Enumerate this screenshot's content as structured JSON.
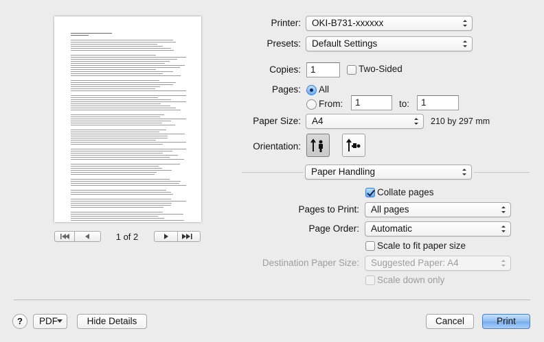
{
  "preview": {
    "page_indicator": "1 of 2"
  },
  "printer": {
    "label": "Printer:",
    "value": "OKI-B731-xxxxxx"
  },
  "presets": {
    "label": "Presets:",
    "value": "Default Settings"
  },
  "copies": {
    "label": "Copies:",
    "value": "1",
    "two_sided_label": "Two-Sided",
    "two_sided_checked": false
  },
  "pages": {
    "label": "Pages:",
    "all_label": "All",
    "from_label": "From:",
    "from_value": "1",
    "to_label": "to:",
    "to_value": "1",
    "selected": "All"
  },
  "paper_size": {
    "label": "Paper Size:",
    "value": "A4",
    "dimensions": "210 by 297 mm"
  },
  "orientation": {
    "label": "Orientation:",
    "selected": "portrait"
  },
  "section": {
    "value": "Paper Handling"
  },
  "collate": {
    "label": "Collate pages",
    "checked": true
  },
  "pages_to_print": {
    "label": "Pages to Print:",
    "value": "All pages"
  },
  "page_order": {
    "label": "Page Order:",
    "value": "Automatic"
  },
  "scale_to_fit": {
    "label": "Scale to fit paper size",
    "checked": false
  },
  "destination_paper_size": {
    "label": "Destination Paper Size:",
    "value": "Suggested Paper: A4"
  },
  "scale_down": {
    "label": "Scale down only",
    "checked": false
  },
  "footer": {
    "help_label": "?",
    "pdf_label": "PDF",
    "hide_details_label": "Hide Details",
    "cancel_label": "Cancel",
    "print_label": "Print"
  },
  "colors": {
    "accent": "#6aa9ee",
    "background": "#ececec"
  }
}
